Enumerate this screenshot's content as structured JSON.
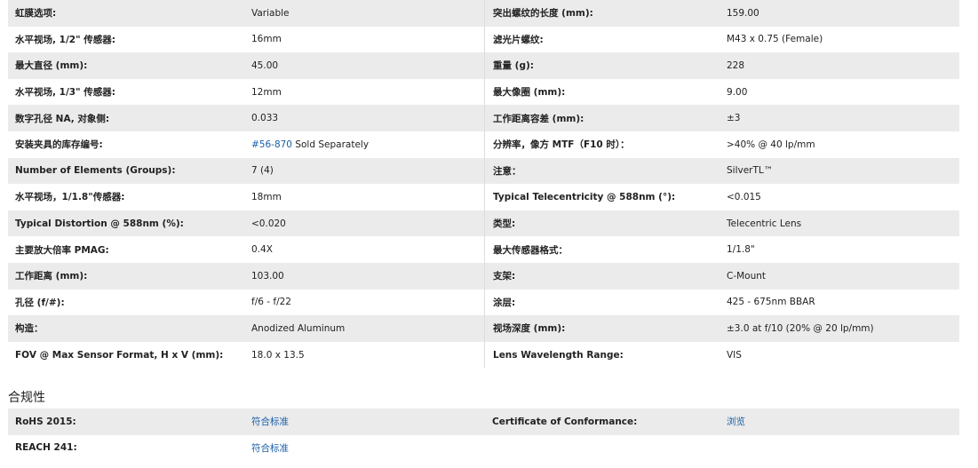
{
  "specs": [
    {
      "l1": "虹膜选项:",
      "v1": "Variable",
      "l2": "突出螺纹的长度 (mm):",
      "v2": "159.00"
    },
    {
      "l1": "水平视场, 1/2\" 传感器:",
      "v1": "16mm",
      "l2": "滤光片螺纹:",
      "v2": "M43 x 0.75 (Female)"
    },
    {
      "l1": "最大直径 (mm):",
      "v1": "45.00",
      "l2": "重量 (g):",
      "v2": "228"
    },
    {
      "l1": "水平视场, 1/3\" 传感器:",
      "v1": "12mm",
      "l2": "最大像圈 (mm):",
      "v2": "9.00"
    },
    {
      "l1": "数字孔径 NA, 对象侧:",
      "v1": "0.033",
      "l2": "工作距离容差 (mm):",
      "v2": "±3"
    },
    {
      "l1": "安装夹具的库存编号:",
      "v1_link": "#56-870",
      "v1": " Sold Separately",
      "l2": "分辨率，像方 MTF（F10 时）：",
      "v2": ">40% @ 40 lp/mm"
    },
    {
      "l1": "Number of Elements (Groups):",
      "v1": "7 (4)",
      "l2": "注意：",
      "v2": "SilverTL™"
    },
    {
      "l1": "水平视场，1/1.8\"传感器:",
      "v1": "18mm",
      "l2": "Typical Telecentricity @ 588nm (°):",
      "v2": "<0.015"
    },
    {
      "l1": "Typical Distortion @ 588nm (%):",
      "v1": "<0.020",
      "l2": "类型:",
      "v2": "Telecentric Lens"
    },
    {
      "l1": "主要放大倍率 PMAG:",
      "v1": "0.4X",
      "l2": "最大传感器格式：",
      "v2": "1/1.8\""
    },
    {
      "l1": "工作距离 (mm):",
      "v1": "103.00",
      "l2": "支架:",
      "v2": "C-Mount"
    },
    {
      "l1": "孔径 (f/#):",
      "v1": "f/6 - f/22",
      "l2": "涂层:",
      "v2": "425 - 675nm BBAR"
    },
    {
      "l1": "构造：",
      "v1": "Anodized Aluminum",
      "l2": "视场深度 (mm):",
      "v2": "±3.0 at f/10 (20% @ 20 lp/mm)"
    },
    {
      "l1": "FOV @ Max Sensor Format, H x V (mm):",
      "v1": "18.0 x 13.5",
      "l2": "Lens Wavelength Range:",
      "v2": "VIS"
    }
  ],
  "compliance": {
    "title": "合规性",
    "rows": [
      {
        "l1": "RoHS 2015:",
        "v1": "符合标准",
        "l2": "Certificate of Conformance:",
        "v2": "浏览"
      },
      {
        "l1": "REACH 241:",
        "v1": "符合标准",
        "l2": "",
        "v2": ""
      }
    ]
  }
}
